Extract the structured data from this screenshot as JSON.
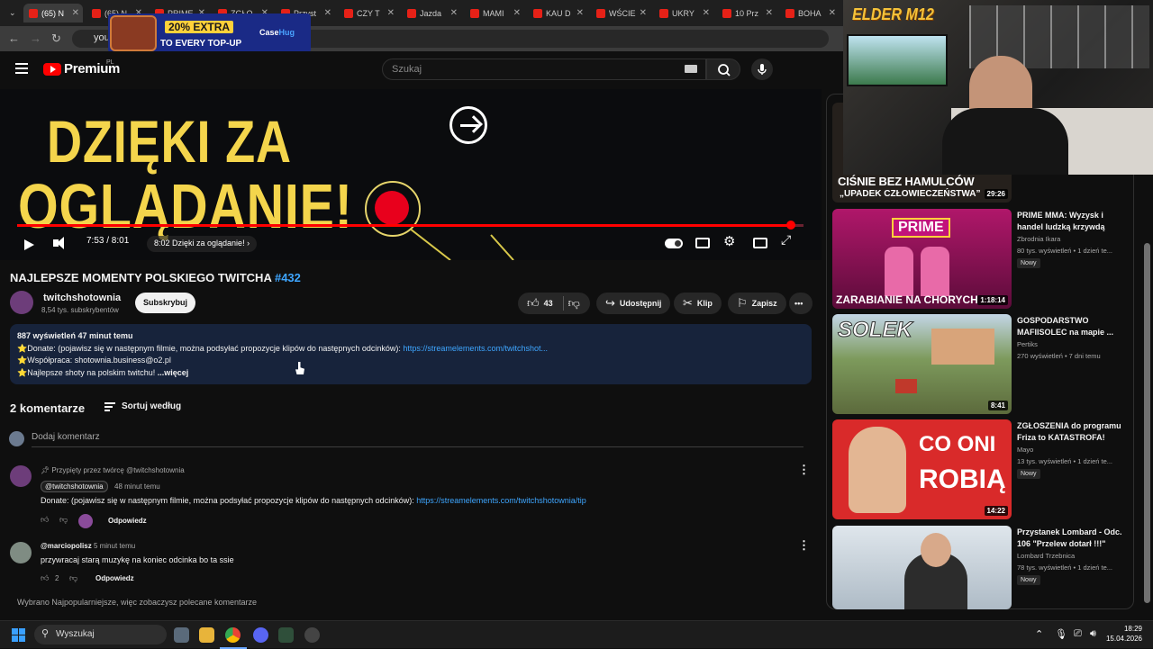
{
  "browser": {
    "tabs": [
      {
        "label": "(65) N",
        "active": true
      },
      {
        "label": "(65) N"
      },
      {
        "label": "PRIME"
      },
      {
        "label": "ZGŁO"
      },
      {
        "label": "Przyst"
      },
      {
        "label": "CZY T"
      },
      {
        "label": "Jazda"
      },
      {
        "label": "MAMI"
      },
      {
        "label": "KAU D"
      },
      {
        "label": "WŚCIE"
      },
      {
        "label": "UKRY"
      },
      {
        "label": "10 Prz"
      },
      {
        "label": "BOHA"
      }
    ],
    "url": "you"
  },
  "ad": {
    "line1": "20% EXTRA",
    "line2": "TO EVERY TOP-UP",
    "brand_a": "Case",
    "brand_b": "Hug"
  },
  "youtube": {
    "logo_text": "Premium",
    "country": "PL",
    "search_placeholder": "Szukaj"
  },
  "video": {
    "overlay_line1": "DZIĘKI ZA",
    "overlay_line2": "OGLĄDANIE!",
    "time": "7:53 / 8:01",
    "chapter": "8:02 Dzięki za oglądanie!",
    "progress": 0.984
  },
  "title": {
    "text": "NAJLEPSZE MOMENTY POLSKIEGO TWITCHA ",
    "tag": "#432"
  },
  "channel": {
    "name": "twitchshotownia",
    "subscribers": "8,54 tys. subskrybentów",
    "subscribe_label": "Subskrybuj"
  },
  "actions": {
    "likes": "43",
    "share": "Udostępnij",
    "clip": "Klip",
    "save": "Zapisz"
  },
  "description": {
    "stats": "887 wyświetleń  47 minut temu",
    "line1_text": "⭐Donate: (pojawisz się w następnym filmie, można podsyłać propozycje klipów do następnych odcinków): ",
    "line1_link": "https://streamelements.com/twitchshot...",
    "line2": "⭐Współpraca: shotownia.business@o2.pl",
    "line3": "⭐Najlepsze shoty na polskim twitchu! ",
    "more": "...więcej"
  },
  "comments": {
    "count_label": "2 komentarze",
    "sort_label": "Sortuj według",
    "add_placeholder": "Dodaj komentarz",
    "footnote": "Wybrano Najpopularniejsze, więc zobaczysz polecane komentarze",
    "items": [
      {
        "pinned": "Przypięty przez twórcę @twitchshotownia",
        "author": "@twitchshotownia",
        "time": "48 minut temu",
        "text": "Donate: (pojawisz się w następnym filmie, można podsyłać propozycje klipów do następnych odcinków): ",
        "link": "https://streamelements.com/twitchshotownia/tip",
        "likes": "",
        "reply": "Odpowiedz"
      },
      {
        "author": "@marciopolisz",
        "time": "5 minut temu",
        "text": "przywracaj starą muzykę na koniec odcinka bo ta ssie",
        "likes": "2",
        "reply": "Odpowiedz"
      }
    ]
  },
  "recommendations": [
    {
      "thumb_text1": "CIŚNIE BEZ HAMULCÓW",
      "thumb_text2": "„UPADEK CZŁOWIECZEŃSTWA”",
      "duration": "29:26"
    },
    {
      "title": "PRIME MMA: Wyzysk i handel ludzką krzywdą",
      "channel": "Zbrodnia Ikara",
      "meta": "80 tys. wyświetleń • 1 dzień te...",
      "badge": "Nowy",
      "duration": "1:18:14",
      "thumb_text1": "PRIME",
      "thumb_text2": "ZARABIANIE NA CHORYCH"
    },
    {
      "title": "GOSPODARSTWO MAFIISOLEC na mapie ...",
      "channel": "Pertiks",
      "meta": "270 wyświetleń • 7 dni temu",
      "badge": "",
      "duration": "8:41",
      "thumb_text1": "SOLEK"
    },
    {
      "title": "ZGŁOSZENIA do programu Friza to KATASTROFA!",
      "channel": "Mayo",
      "meta": "13 tys. wyświetleń • 1 dzień te...",
      "badge": "Nowy",
      "duration": "14:22",
      "thumb_text1": "CO ONI",
      "thumb_text2": "ROBIĄ"
    },
    {
      "title": "Przystanek Lombard - Odc. 106 \"Przelew dotarł !!!\"",
      "channel": "Lombard Trzebnica",
      "meta": "78 tys. wyświetleń • 1 dzień te...",
      "badge": "Nowy",
      "duration": ""
    }
  ],
  "stream_overlay": {
    "brand": "ELDER M12"
  },
  "taskbar": {
    "search": "Wyszukaj",
    "time": "18:29",
    "date": "15.04.2026"
  }
}
